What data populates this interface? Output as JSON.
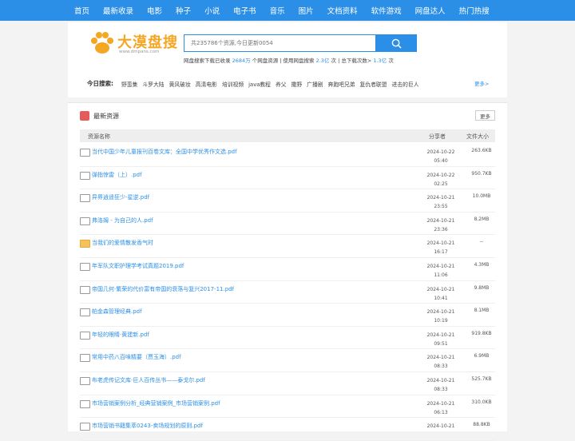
{
  "nav": [
    "首页",
    "最新收录",
    "电影",
    "种子",
    "小说",
    "电子书",
    "音乐",
    "图片",
    "文档资料",
    "软件游戏",
    "网盘达人",
    "热门热搜"
  ],
  "logo": {
    "title": "大漠盘搜",
    "subtitle": "www.dmpans.com"
  },
  "search": {
    "placeholder": "共235786个资源,今日更新0054"
  },
  "stats": {
    "prefix": "网盘搜索下载已收录",
    "resources": "2684万",
    "mid1": "个网盘资源 | 使用网盘搜索",
    "uses": "2.3亿",
    "mid2": "次 | 总下载次数>",
    "downloads": "1.3亿",
    "suffix": "次"
  },
  "today": {
    "label": "今日搜索:",
    "items": [
      "野蛮集",
      "斗罗大陆",
      "黄风破妆",
      "高清电影",
      "培训视频",
      "java教程",
      "养父",
      "撒野",
      "广播剧",
      "奔跑吧兄弟",
      "复仇者联盟",
      "进击的巨人"
    ],
    "more": "更多>"
  },
  "list": {
    "title": "最新资源",
    "more": "更多",
    "headers": {
      "name": "资源名称",
      "sharer": "分享者",
      "size": "文件大小"
    },
    "rows": [
      {
        "name": "当代中国少年儿童报刊百卷文库：全国中学优秀作文选.pdf",
        "date": "2024-10-22",
        "time": "05:40",
        "size": "263.6KB",
        "icon": "file-icon"
      },
      {
        "name": "弹指惊雷（上）.pdf",
        "date": "2024-10-22",
        "time": "02:25",
        "size": "950.7KB",
        "icon": "file-icon"
      },
      {
        "name": "异界逍遥狂少-星逆.pdf",
        "date": "2024-10-21",
        "time": "23:55",
        "size": "10.0MB",
        "icon": "file-icon"
      },
      {
        "name": "弗洛姆 - 为自己的人.pdf",
        "date": "2024-10-21",
        "time": "23:36",
        "size": "8.2MB",
        "icon": "file-icon"
      },
      {
        "name": "当我们的爱情散发香气时",
        "date": "2024-10-21",
        "time": "16:17",
        "size": "--",
        "icon": "folder-icon"
      },
      {
        "name": "年军队文职护理学考试真题2019.pdf",
        "date": "2024-10-21",
        "time": "11:06",
        "size": "4.3MB",
        "icon": "file-icon"
      },
      {
        "name": "帝国几何·繁荣的代价富有帝国的衰落与复兴2017-11.pdf",
        "date": "2024-10-21",
        "time": "10:41",
        "size": "9.8MB",
        "icon": "file-icon"
      },
      {
        "name": "帕金森管理经典.pdf",
        "date": "2024-10-21",
        "time": "10:19",
        "size": "8.1MB",
        "icon": "file-icon"
      },
      {
        "name": "年轻的眼睛·黄建新.pdf",
        "date": "2024-10-21",
        "time": "09:51",
        "size": "919.8KB",
        "icon": "file-icon"
      },
      {
        "name": "常用中药八百味精要（贾玉海）.pdf",
        "date": "2024-10-21",
        "time": "08:33",
        "size": "6.9MB",
        "icon": "file-icon"
      },
      {
        "name": "布老虎传记文库·巨人百传丛书——泰戈尔.pdf",
        "date": "2024-10-21",
        "time": "08:33",
        "size": "525.7KB",
        "icon": "file-icon"
      },
      {
        "name": "市场营销案例分析_经典营销案例_市场营销案例.pdf",
        "date": "2024-10-21",
        "time": "06:13",
        "size": "310.0KB",
        "icon": "file-icon"
      },
      {
        "name": "市场营销书籍集萃0243-卖场规划的原则.pdf",
        "date": "2024-10-21",
        "time": "",
        "size": "88.8KB",
        "icon": "file-icon"
      }
    ]
  },
  "colors": {
    "accent": "#2b8fe8",
    "logo": "#f5a623"
  }
}
